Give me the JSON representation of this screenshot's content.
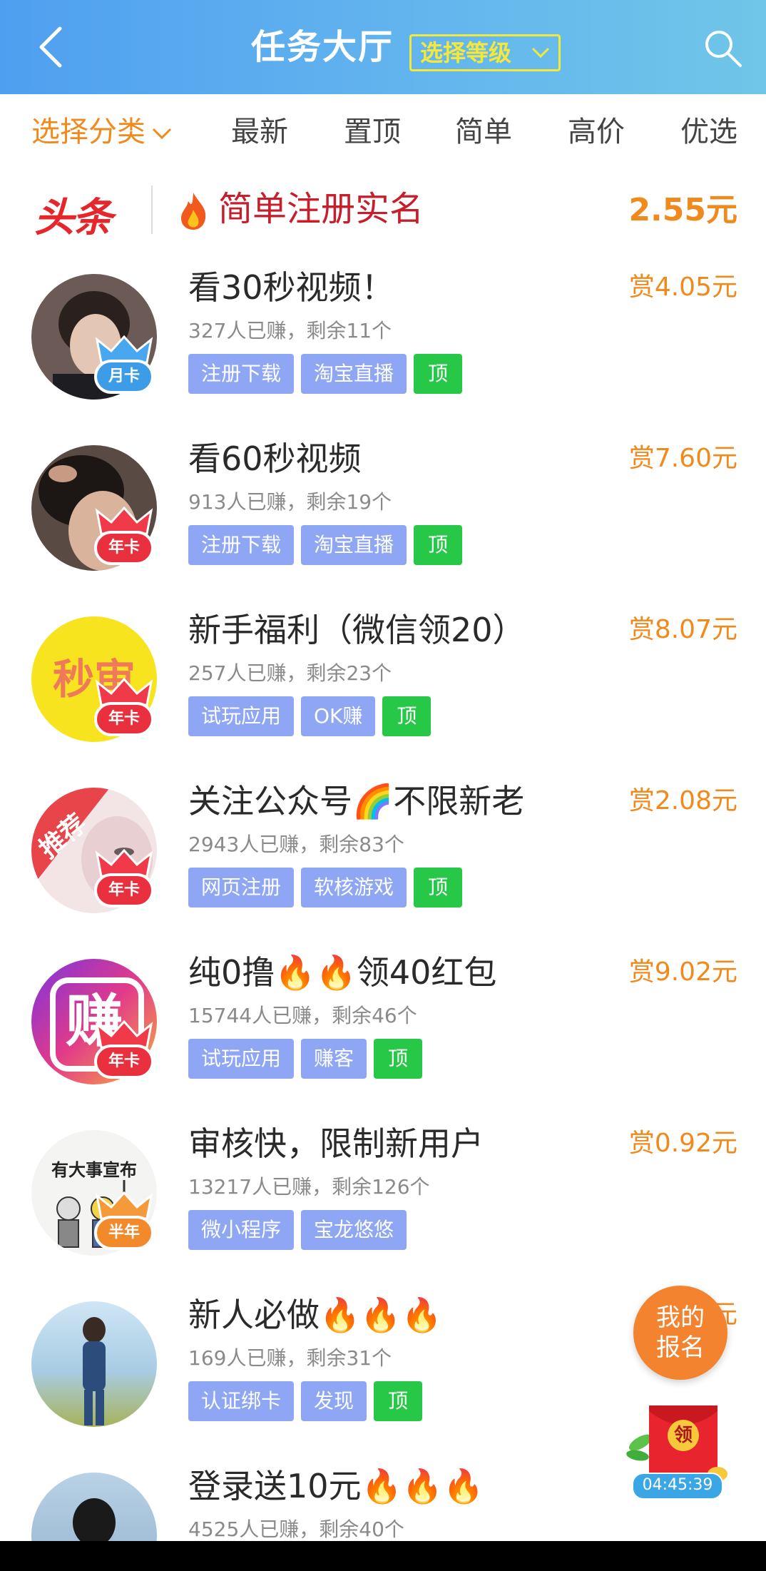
{
  "header": {
    "title": "任务大厅",
    "level_button": "选择等级",
    "colors": {
      "gradient_start": "#4f9ff0",
      "gradient_end": "#6fc6e8",
      "level_accent": "#f4e93a"
    }
  },
  "tabs": {
    "category": "选择分类",
    "items": [
      "最新",
      "置顶",
      "简单",
      "高价",
      "优选"
    ]
  },
  "headline": {
    "logo": "头条",
    "text": "简单注册实名",
    "price": "2.55元"
  },
  "tasks": [
    {
      "title": "看30秒视频！",
      "stats": "327人已赚，剩余11个",
      "tags": [
        "注册下载",
        "淘宝直播"
      ],
      "top": "顶",
      "reward": "赏4.05元",
      "badge": "月卡",
      "avatar_icon": "person-photo"
    },
    {
      "title": "看60秒视频",
      "stats": "913人已赚，剩余19个",
      "tags": [
        "注册下载",
        "淘宝直播"
      ],
      "top": "顶",
      "reward": "赏7.60元",
      "badge": "年卡",
      "avatar_icon": "person-photo"
    },
    {
      "title": "新手福利（微信领20）",
      "stats": "257人已赚，剩余23个",
      "tags": [
        "试玩应用",
        "OK赚"
      ],
      "top": "顶",
      "reward": "赏8.07元",
      "badge": "年卡",
      "avatar_text": "秒审"
    },
    {
      "title": "关注公众号🌈不限新老",
      "stats": "2943人已赚，剩余83个",
      "tags": [
        "网页注册",
        "软核游戏"
      ],
      "top": "顶",
      "reward": "赏2.08元",
      "badge": "年卡",
      "avatar_text": "推荐"
    },
    {
      "title": "纯0撸🔥🔥领40红包",
      "stats": "15744人已赚，剩余46个",
      "tags": [
        "试玩应用",
        "赚客"
      ],
      "top": "顶",
      "reward": "赏9.02元",
      "badge": "年卡",
      "avatar_text": "赚"
    },
    {
      "title": "审核快，限制新用户",
      "stats": "13217人已赚，剩余126个",
      "tags": [
        "微小程序",
        "宝龙悠悠"
      ],
      "top": "",
      "reward": "赏0.92元",
      "badge": "半年",
      "avatar_text": "有大事宣布"
    },
    {
      "title": "新人必做🔥🔥🔥",
      "stats": "169人已赚，剩余31个",
      "tags": [
        "认证绑卡",
        "发现"
      ],
      "top": "顶",
      "reward": "赏…元",
      "badge": "",
      "avatar_icon": "person-photo"
    },
    {
      "title": "登录送10元🔥🔥🔥",
      "stats": "4525人已赚，剩余40个",
      "tags": [],
      "top": "",
      "reward": "…元",
      "badge": "",
      "avatar_icon": "person-photo"
    }
  ],
  "floating": {
    "signup_line1": "我的",
    "signup_line2": "报名",
    "redpack_label": "领",
    "timer": "04:45:39"
  }
}
